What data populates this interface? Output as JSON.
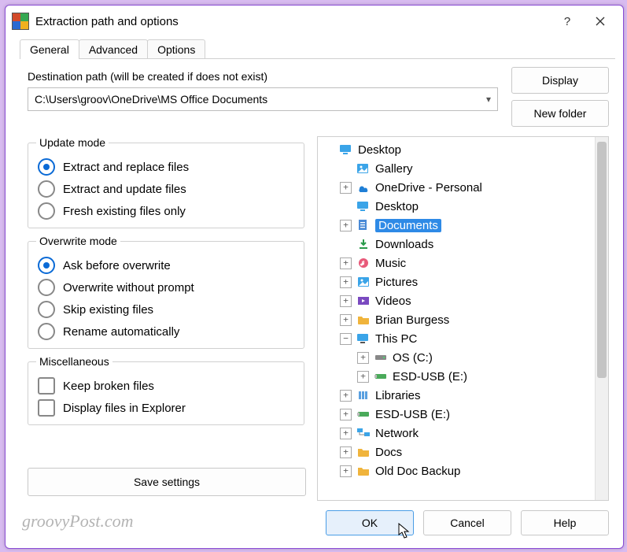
{
  "window": {
    "title": "Extraction path and options"
  },
  "tabs": {
    "general": "General",
    "advanced": "Advanced",
    "options": "Options"
  },
  "dest": {
    "label": "Destination path (will be created if does not exist)",
    "value": "C:\\Users\\groov\\OneDrive\\MS Office Documents"
  },
  "buttons": {
    "display": "Display",
    "newfolder": "New folder",
    "save": "Save settings",
    "ok": "OK",
    "cancel": "Cancel",
    "help": "Help"
  },
  "groups": {
    "update": {
      "legend": "Update mode",
      "opt1": "Extract and replace files",
      "opt2": "Extract and update files",
      "opt3": "Fresh existing files only"
    },
    "overwrite": {
      "legend": "Overwrite mode",
      "opt1": "Ask before overwrite",
      "opt2": "Overwrite without prompt",
      "opt3": "Skip existing files",
      "opt4": "Rename automatically"
    },
    "misc": {
      "legend": "Miscellaneous",
      "opt1": "Keep broken files",
      "opt2": "Display files in Explorer"
    }
  },
  "tree": [
    {
      "indent": 0,
      "exp": "none",
      "icon": "desktop",
      "label": "Desktop"
    },
    {
      "indent": 1,
      "exp": "none",
      "icon": "gallery",
      "label": "Gallery"
    },
    {
      "indent": 1,
      "exp": "plus",
      "icon": "onedrive",
      "label": "OneDrive - Personal"
    },
    {
      "indent": 1,
      "exp": "none",
      "icon": "desktop",
      "label": "Desktop"
    },
    {
      "indent": 1,
      "exp": "plus",
      "icon": "docs",
      "label": "Documents",
      "selected": true
    },
    {
      "indent": 1,
      "exp": "none",
      "icon": "download",
      "label": "Downloads"
    },
    {
      "indent": 1,
      "exp": "plus",
      "icon": "music",
      "label": "Music"
    },
    {
      "indent": 1,
      "exp": "plus",
      "icon": "pictures",
      "label": "Pictures"
    },
    {
      "indent": 1,
      "exp": "plus",
      "icon": "videos",
      "label": "Videos"
    },
    {
      "indent": 1,
      "exp": "plus",
      "icon": "folder",
      "label": "Brian Burgess"
    },
    {
      "indent": 1,
      "exp": "minus",
      "icon": "pc",
      "label": "This PC"
    },
    {
      "indent": 2,
      "exp": "plus",
      "icon": "drive",
      "label": "OS (C:)"
    },
    {
      "indent": 2,
      "exp": "plus",
      "icon": "usb",
      "label": "ESD-USB (E:)"
    },
    {
      "indent": 1,
      "exp": "plus",
      "icon": "libraries",
      "label": "Libraries"
    },
    {
      "indent": 1,
      "exp": "plus",
      "icon": "usb",
      "label": "ESD-USB (E:)"
    },
    {
      "indent": 1,
      "exp": "plus",
      "icon": "network",
      "label": "Network"
    },
    {
      "indent": 1,
      "exp": "plus",
      "icon": "folder",
      "label": "Docs"
    },
    {
      "indent": 1,
      "exp": "plus",
      "icon": "folder",
      "label": "Old Doc Backup"
    }
  ],
  "watermark": "groovyPost.com"
}
